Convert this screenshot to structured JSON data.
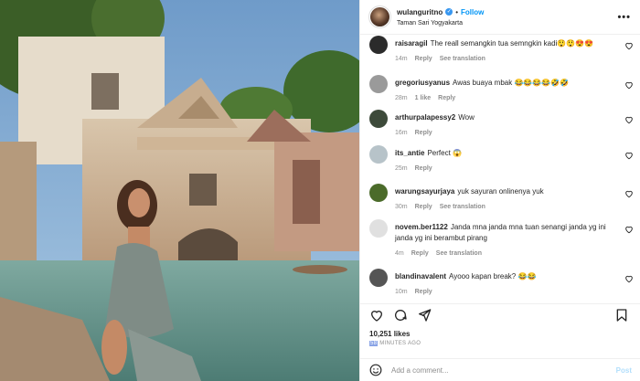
{
  "header": {
    "username": "wulanguritno",
    "separator": "•",
    "follow_label": "Follow",
    "location": "Taman Sari Yogyakarta",
    "more_glyph": "•••"
  },
  "comments": [
    {
      "user": "raisaragil",
      "text": "The reall semangkin tua semngkin kadi😲😲😍😍",
      "age": "14m",
      "likes": "",
      "reply": "Reply",
      "translate": "See translation",
      "avatar_color": "#2b2b2b"
    },
    {
      "user": "gregoriusyanus",
      "text": "Awas buaya mbak 😂😂😂😂🤣🤣",
      "age": "28m",
      "likes": "1 like",
      "reply": "Reply",
      "translate": "",
      "avatar_color": "#9a9a9a"
    },
    {
      "user": "arthurpalapessy2",
      "text": "Wow",
      "age": "16m",
      "likes": "",
      "reply": "Reply",
      "translate": "",
      "avatar_color": "#3d4a3a"
    },
    {
      "user": "its_antie",
      "text": "Perfect 😱",
      "age": "25m",
      "likes": "",
      "reply": "Reply",
      "translate": "",
      "avatar_color": "#b7c3c9"
    },
    {
      "user": "warungsayurjaya",
      "text": "yuk sayuran onlinenya yuk",
      "age": "30m",
      "likes": "",
      "reply": "Reply",
      "translate": "See translation",
      "avatar_color": "#4b6b2a"
    },
    {
      "user": "novem.ber1122",
      "text": "Janda mna janda mna tuan senangi janda yg ini janda yg ini berambut pirang",
      "age": "4m",
      "likes": "",
      "reply": "Reply",
      "translate": "See translation",
      "avatar_color": "#e0e0e0"
    },
    {
      "user": "blandinavalent",
      "text": "Ayooo kapan break? 😂😂",
      "age": "10m",
      "likes": "",
      "reply": "Reply",
      "translate": "",
      "avatar_color": "#555555"
    }
  ],
  "stats": {
    "likes": "10,251 likes",
    "time_highlight": "58",
    "time_rest": " MINUTES AGO"
  },
  "add_comment": {
    "placeholder": "Add a comment...",
    "post_label": "Post"
  },
  "colors": {
    "accent": "#0095f6",
    "verified": "#3897f0",
    "muted": "#8e8e8e",
    "post_disabled": "#b2dffc"
  },
  "icons": {
    "like": "heart-icon",
    "comment": "comment-icon",
    "share": "share-icon",
    "save": "bookmark-icon",
    "emoji": "smiley-icon"
  }
}
